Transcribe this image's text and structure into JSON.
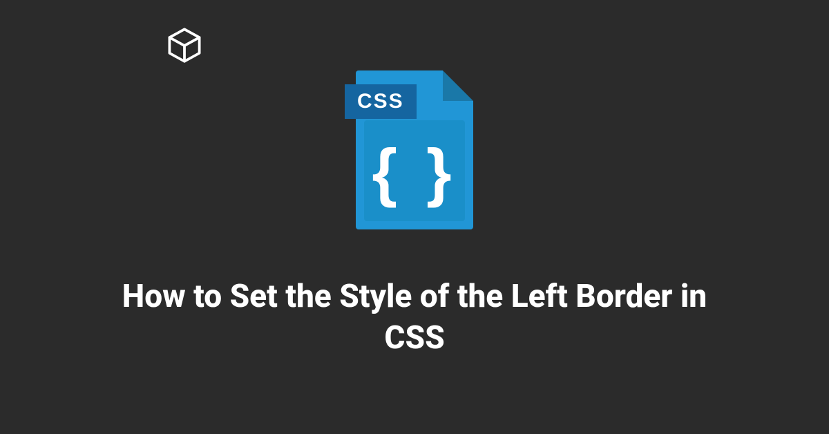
{
  "logo": {
    "name": "cube-icon"
  },
  "file_icon": {
    "badge_text": "CSS",
    "braces_text": "{ }"
  },
  "title": "How to Set the Style of the Left Border in CSS"
}
